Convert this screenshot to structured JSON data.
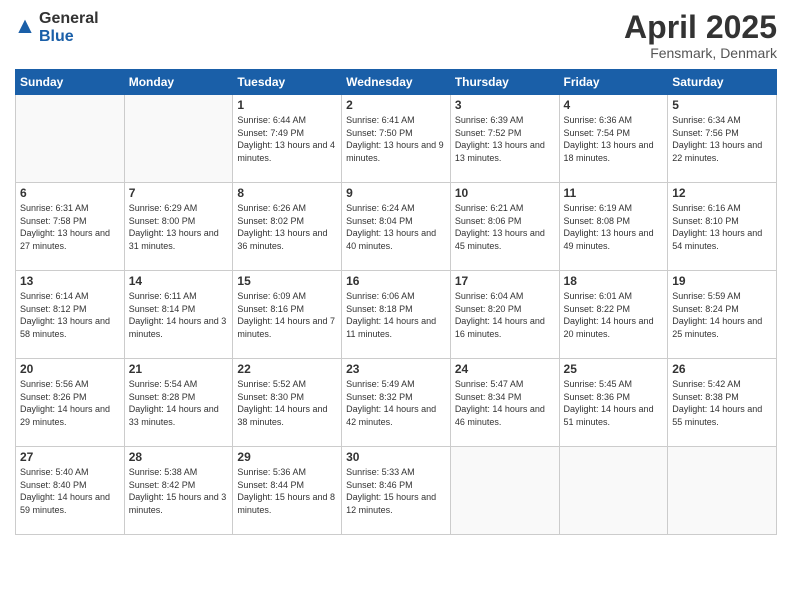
{
  "header": {
    "logo_general": "General",
    "logo_blue": "Blue",
    "title": "April 2025",
    "location": "Fensmark, Denmark"
  },
  "days_of_week": [
    "Sunday",
    "Monday",
    "Tuesday",
    "Wednesday",
    "Thursday",
    "Friday",
    "Saturday"
  ],
  "weeks": [
    [
      {
        "day": "",
        "info": ""
      },
      {
        "day": "",
        "info": ""
      },
      {
        "day": "1",
        "info": "Sunrise: 6:44 AM\nSunset: 7:49 PM\nDaylight: 13 hours and 4 minutes."
      },
      {
        "day": "2",
        "info": "Sunrise: 6:41 AM\nSunset: 7:50 PM\nDaylight: 13 hours and 9 minutes."
      },
      {
        "day": "3",
        "info": "Sunrise: 6:39 AM\nSunset: 7:52 PM\nDaylight: 13 hours and 13 minutes."
      },
      {
        "day": "4",
        "info": "Sunrise: 6:36 AM\nSunset: 7:54 PM\nDaylight: 13 hours and 18 minutes."
      },
      {
        "day": "5",
        "info": "Sunrise: 6:34 AM\nSunset: 7:56 PM\nDaylight: 13 hours and 22 minutes."
      }
    ],
    [
      {
        "day": "6",
        "info": "Sunrise: 6:31 AM\nSunset: 7:58 PM\nDaylight: 13 hours and 27 minutes."
      },
      {
        "day": "7",
        "info": "Sunrise: 6:29 AM\nSunset: 8:00 PM\nDaylight: 13 hours and 31 minutes."
      },
      {
        "day": "8",
        "info": "Sunrise: 6:26 AM\nSunset: 8:02 PM\nDaylight: 13 hours and 36 minutes."
      },
      {
        "day": "9",
        "info": "Sunrise: 6:24 AM\nSunset: 8:04 PM\nDaylight: 13 hours and 40 minutes."
      },
      {
        "day": "10",
        "info": "Sunrise: 6:21 AM\nSunset: 8:06 PM\nDaylight: 13 hours and 45 minutes."
      },
      {
        "day": "11",
        "info": "Sunrise: 6:19 AM\nSunset: 8:08 PM\nDaylight: 13 hours and 49 minutes."
      },
      {
        "day": "12",
        "info": "Sunrise: 6:16 AM\nSunset: 8:10 PM\nDaylight: 13 hours and 54 minutes."
      }
    ],
    [
      {
        "day": "13",
        "info": "Sunrise: 6:14 AM\nSunset: 8:12 PM\nDaylight: 13 hours and 58 minutes."
      },
      {
        "day": "14",
        "info": "Sunrise: 6:11 AM\nSunset: 8:14 PM\nDaylight: 14 hours and 3 minutes."
      },
      {
        "day": "15",
        "info": "Sunrise: 6:09 AM\nSunset: 8:16 PM\nDaylight: 14 hours and 7 minutes."
      },
      {
        "day": "16",
        "info": "Sunrise: 6:06 AM\nSunset: 8:18 PM\nDaylight: 14 hours and 11 minutes."
      },
      {
        "day": "17",
        "info": "Sunrise: 6:04 AM\nSunset: 8:20 PM\nDaylight: 14 hours and 16 minutes."
      },
      {
        "day": "18",
        "info": "Sunrise: 6:01 AM\nSunset: 8:22 PM\nDaylight: 14 hours and 20 minutes."
      },
      {
        "day": "19",
        "info": "Sunrise: 5:59 AM\nSunset: 8:24 PM\nDaylight: 14 hours and 25 minutes."
      }
    ],
    [
      {
        "day": "20",
        "info": "Sunrise: 5:56 AM\nSunset: 8:26 PM\nDaylight: 14 hours and 29 minutes."
      },
      {
        "day": "21",
        "info": "Sunrise: 5:54 AM\nSunset: 8:28 PM\nDaylight: 14 hours and 33 minutes."
      },
      {
        "day": "22",
        "info": "Sunrise: 5:52 AM\nSunset: 8:30 PM\nDaylight: 14 hours and 38 minutes."
      },
      {
        "day": "23",
        "info": "Sunrise: 5:49 AM\nSunset: 8:32 PM\nDaylight: 14 hours and 42 minutes."
      },
      {
        "day": "24",
        "info": "Sunrise: 5:47 AM\nSunset: 8:34 PM\nDaylight: 14 hours and 46 minutes."
      },
      {
        "day": "25",
        "info": "Sunrise: 5:45 AM\nSunset: 8:36 PM\nDaylight: 14 hours and 51 minutes."
      },
      {
        "day": "26",
        "info": "Sunrise: 5:42 AM\nSunset: 8:38 PM\nDaylight: 14 hours and 55 minutes."
      }
    ],
    [
      {
        "day": "27",
        "info": "Sunrise: 5:40 AM\nSunset: 8:40 PM\nDaylight: 14 hours and 59 minutes."
      },
      {
        "day": "28",
        "info": "Sunrise: 5:38 AM\nSunset: 8:42 PM\nDaylight: 15 hours and 3 minutes."
      },
      {
        "day": "29",
        "info": "Sunrise: 5:36 AM\nSunset: 8:44 PM\nDaylight: 15 hours and 8 minutes."
      },
      {
        "day": "30",
        "info": "Sunrise: 5:33 AM\nSunset: 8:46 PM\nDaylight: 15 hours and 12 minutes."
      },
      {
        "day": "",
        "info": ""
      },
      {
        "day": "",
        "info": ""
      },
      {
        "day": "",
        "info": ""
      }
    ]
  ]
}
